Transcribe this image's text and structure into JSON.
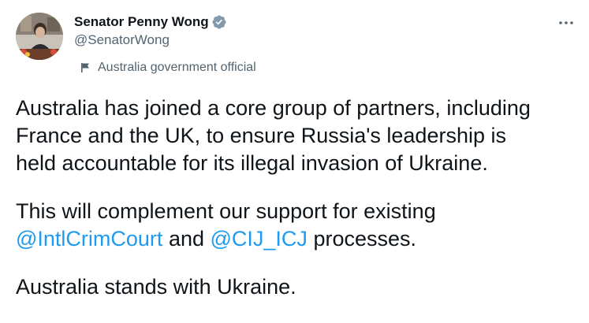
{
  "author": {
    "display_name": "Senator Penny Wong",
    "handle": "@SenatorWong",
    "verified": true,
    "label": "Australia government official",
    "avatar_alt": "Senator Penny Wong profile photo"
  },
  "menu": {
    "more_icon": "ellipsis-horizontal-icon"
  },
  "tweet": {
    "para1_line1": "Australia has joined a core group of partners, including",
    "para1_line2": "France and the UK, to ensure Russia's leadership is",
    "para1_line3": "held accountable for its illegal invasion of Ukraine.",
    "para2_line1": "This will complement our support for existing",
    "mention1": "@IntlCrimCourt",
    "para2_and": " and ",
    "mention2": "@CIJ_ICJ",
    "para2_end": " processes.",
    "para3_line1": "Australia stands with Ukraine."
  },
  "colors": {
    "text": "#0f1419",
    "secondary": "#536471",
    "link": "#1d9bf0",
    "verified": "#829aab"
  }
}
